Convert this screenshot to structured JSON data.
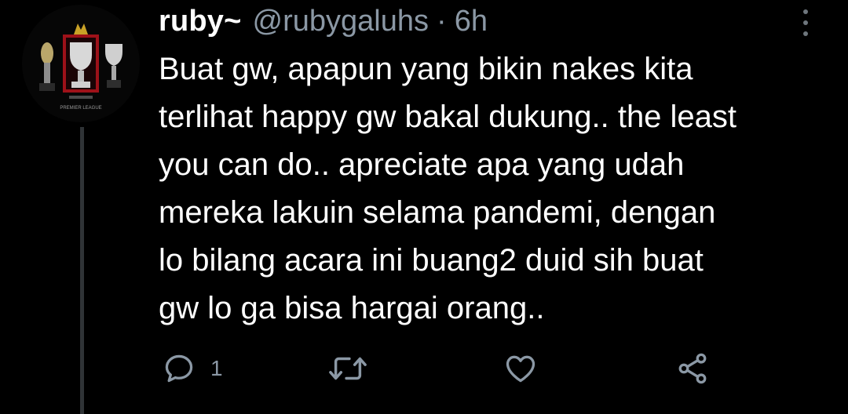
{
  "tweet": {
    "display_name": "ruby~",
    "handle": "@rubygaluhs",
    "separator": "·",
    "timestamp": "6h",
    "text_lines": [
      "Buat gw, apapun yang bikin nakes kita",
      "terlihat happy gw bakal dukung.. the least",
      "you can do.. apreciate apa yang udah",
      "mereka lakuin selama pandemi, dengan",
      "lo bilang acara ini buang2 duid sih buat",
      "gw lo ga bisa hargai orang.."
    ],
    "avatar_text": {
      "badge": "PREMIER LEAGUE"
    }
  },
  "actions": {
    "reply_icon": "reply-icon",
    "reply_count": "1",
    "retweet_icon": "retweet-icon",
    "like_icon": "heart-icon",
    "share_icon": "share-icon"
  },
  "colors": {
    "background": "#000000",
    "primary_text": "#ffffff",
    "secondary_text": "#8b98a5",
    "icon": "#8b98a5",
    "thread_line": "#2f3336",
    "trophy_silver": "#c8c8c8",
    "trophy_red": "#b4121a"
  }
}
